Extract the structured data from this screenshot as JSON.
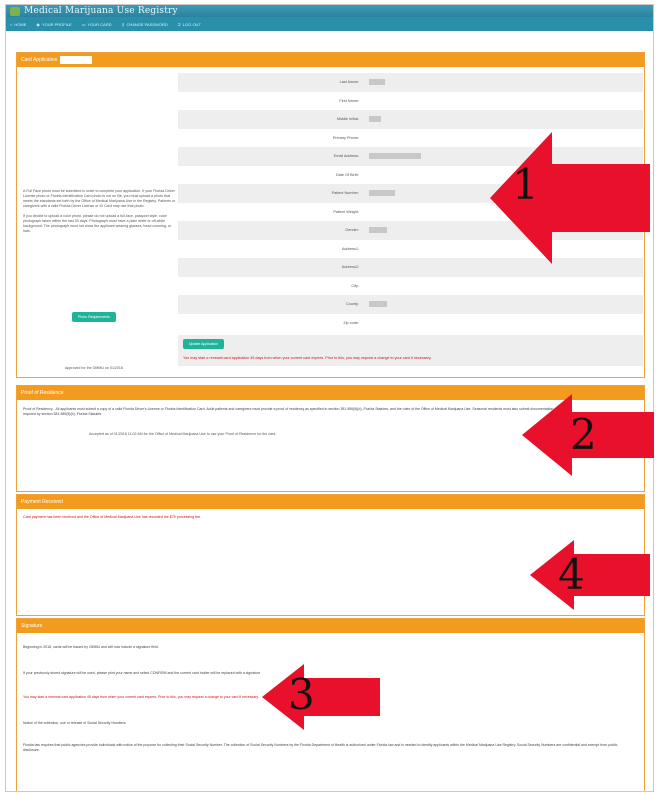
{
  "app": {
    "title": "Medical Marijuana Use Registry"
  },
  "nav": [
    {
      "icon": "home-icon",
      "glyph": "⌂",
      "label": "Home"
    },
    {
      "icon": "user-icon",
      "glyph": "◉",
      "label": "Your Profile"
    },
    {
      "icon": "card-icon",
      "glyph": "▭",
      "label": "Your Card"
    },
    {
      "icon": "key-icon",
      "glyph": "⚷",
      "label": "Change Password"
    },
    {
      "icon": "logout-icon",
      "glyph": "⎋",
      "label": "Log Out"
    }
  ],
  "card_panel": {
    "title": "Card Application",
    "left_paragraph_1": "A Full Face photo must be submitted in order to complete your application. If your Florida Driver License photo or Florida Identification Card photo is not on file, you must upload a photo that meets the standards set forth by the Office of Medical Marijuana Use in the Registry. Patients or caregivers with a valid Florida Driver License or ID Card may use that photo.",
    "left_paragraph_2": "If you decide to upload a color photo, please do not upload a full-face, passport style, color photograph taken within the last 30 days. Photograph must have a plain white or off-white background. The photograph must not show the applicant wearing glasses, head covering, or hats.",
    "photo_button": "Photo Requirements",
    "approved": "Approved for the OMMU on 01/2018",
    "fields": [
      {
        "label": "Last Name:",
        "value": ""
      },
      {
        "label": "First Name:",
        "value": ""
      },
      {
        "label": "Middle Initial:",
        "value": ""
      },
      {
        "label": "Primary Phone:",
        "value": ""
      },
      {
        "label": "Email Address:",
        "value": ""
      },
      {
        "label": "Date Of Birth:",
        "value": ""
      },
      {
        "label": "Patient Number:",
        "value": ""
      },
      {
        "label": "Patient Weight:",
        "value": ""
      },
      {
        "label": "Gender:",
        "value": ""
      },
      {
        "label": "Address1:",
        "value": ""
      },
      {
        "label": "Address2:",
        "value": ""
      },
      {
        "label": "City:",
        "value": ""
      },
      {
        "label": "County:",
        "value": ""
      },
      {
        "label": "Zip code:",
        "value": ""
      }
    ],
    "update_button": "Update Application",
    "notice": "You may start a renewal card application 45 days from when your current card expires. Prior to this, you may request a change to your card if necessary."
  },
  "residence_panel": {
    "title": "Proof of Residence",
    "text": "Proof of Residency - All applicants must submit a copy of a valid Florida Driver's License or Florida Identification Card. Adult patients and caregivers must provide a proof of residency as specified in section 381.986(5)(b), Florida Statutes, and the rules of the Office of Medical Marijuana Use. Seasonal residents must also submit documentation as required by section 381.986(5)(b), Florida Statutes.",
    "accepted": "Accepted as of 01/2018 11:02 AM for the Office of Medical Marijuana Use to use your Proof of Residence for the card."
  },
  "payment_panel": {
    "title": "Payment Received",
    "text": "Card payment has been received and the Office of Medical Marijuana Use has recorded the $75 processing fee."
  },
  "signature_panel": {
    "title": "Signature",
    "line_1": "Beginning in 2018, cards will be issued by OMMU and will now include a signature field.",
    "line_2": "If your previously stored signature will be used, please print your name and select CONFIRM and the current card holder will be replaced with a signature.",
    "line_3": "You may start a renewal card application 45 days from when your current card expires. Prior to this, you may request a change to your card if necessary.",
    "line_4": "Notice of the collection, use or release of Social Security Numbers.",
    "line_5": "Florida law requires that public agencies provide individuals with notice of the purpose for collecting their Social Security Number. The collection of Social Security Numbers by the Florida Department of Health is authorized under Florida law and is needed to identify applicants within the Medical Marijuana Use Registry. Social Security Numbers are confidential and exempt from public disclosure."
  },
  "colors": {
    "accent": "#f39b1f",
    "nav": "#2a8faa",
    "button": "#1fb49a",
    "arrow": "#e8102a",
    "notice": "#d01010"
  },
  "annotations": [
    {
      "icon": "red-arrow-icon",
      "number": "1"
    },
    {
      "icon": "red-arrow-icon",
      "number": "2"
    },
    {
      "icon": "red-arrow-icon",
      "number": "4"
    },
    {
      "icon": "red-arrow-icon",
      "number": "3"
    }
  ]
}
